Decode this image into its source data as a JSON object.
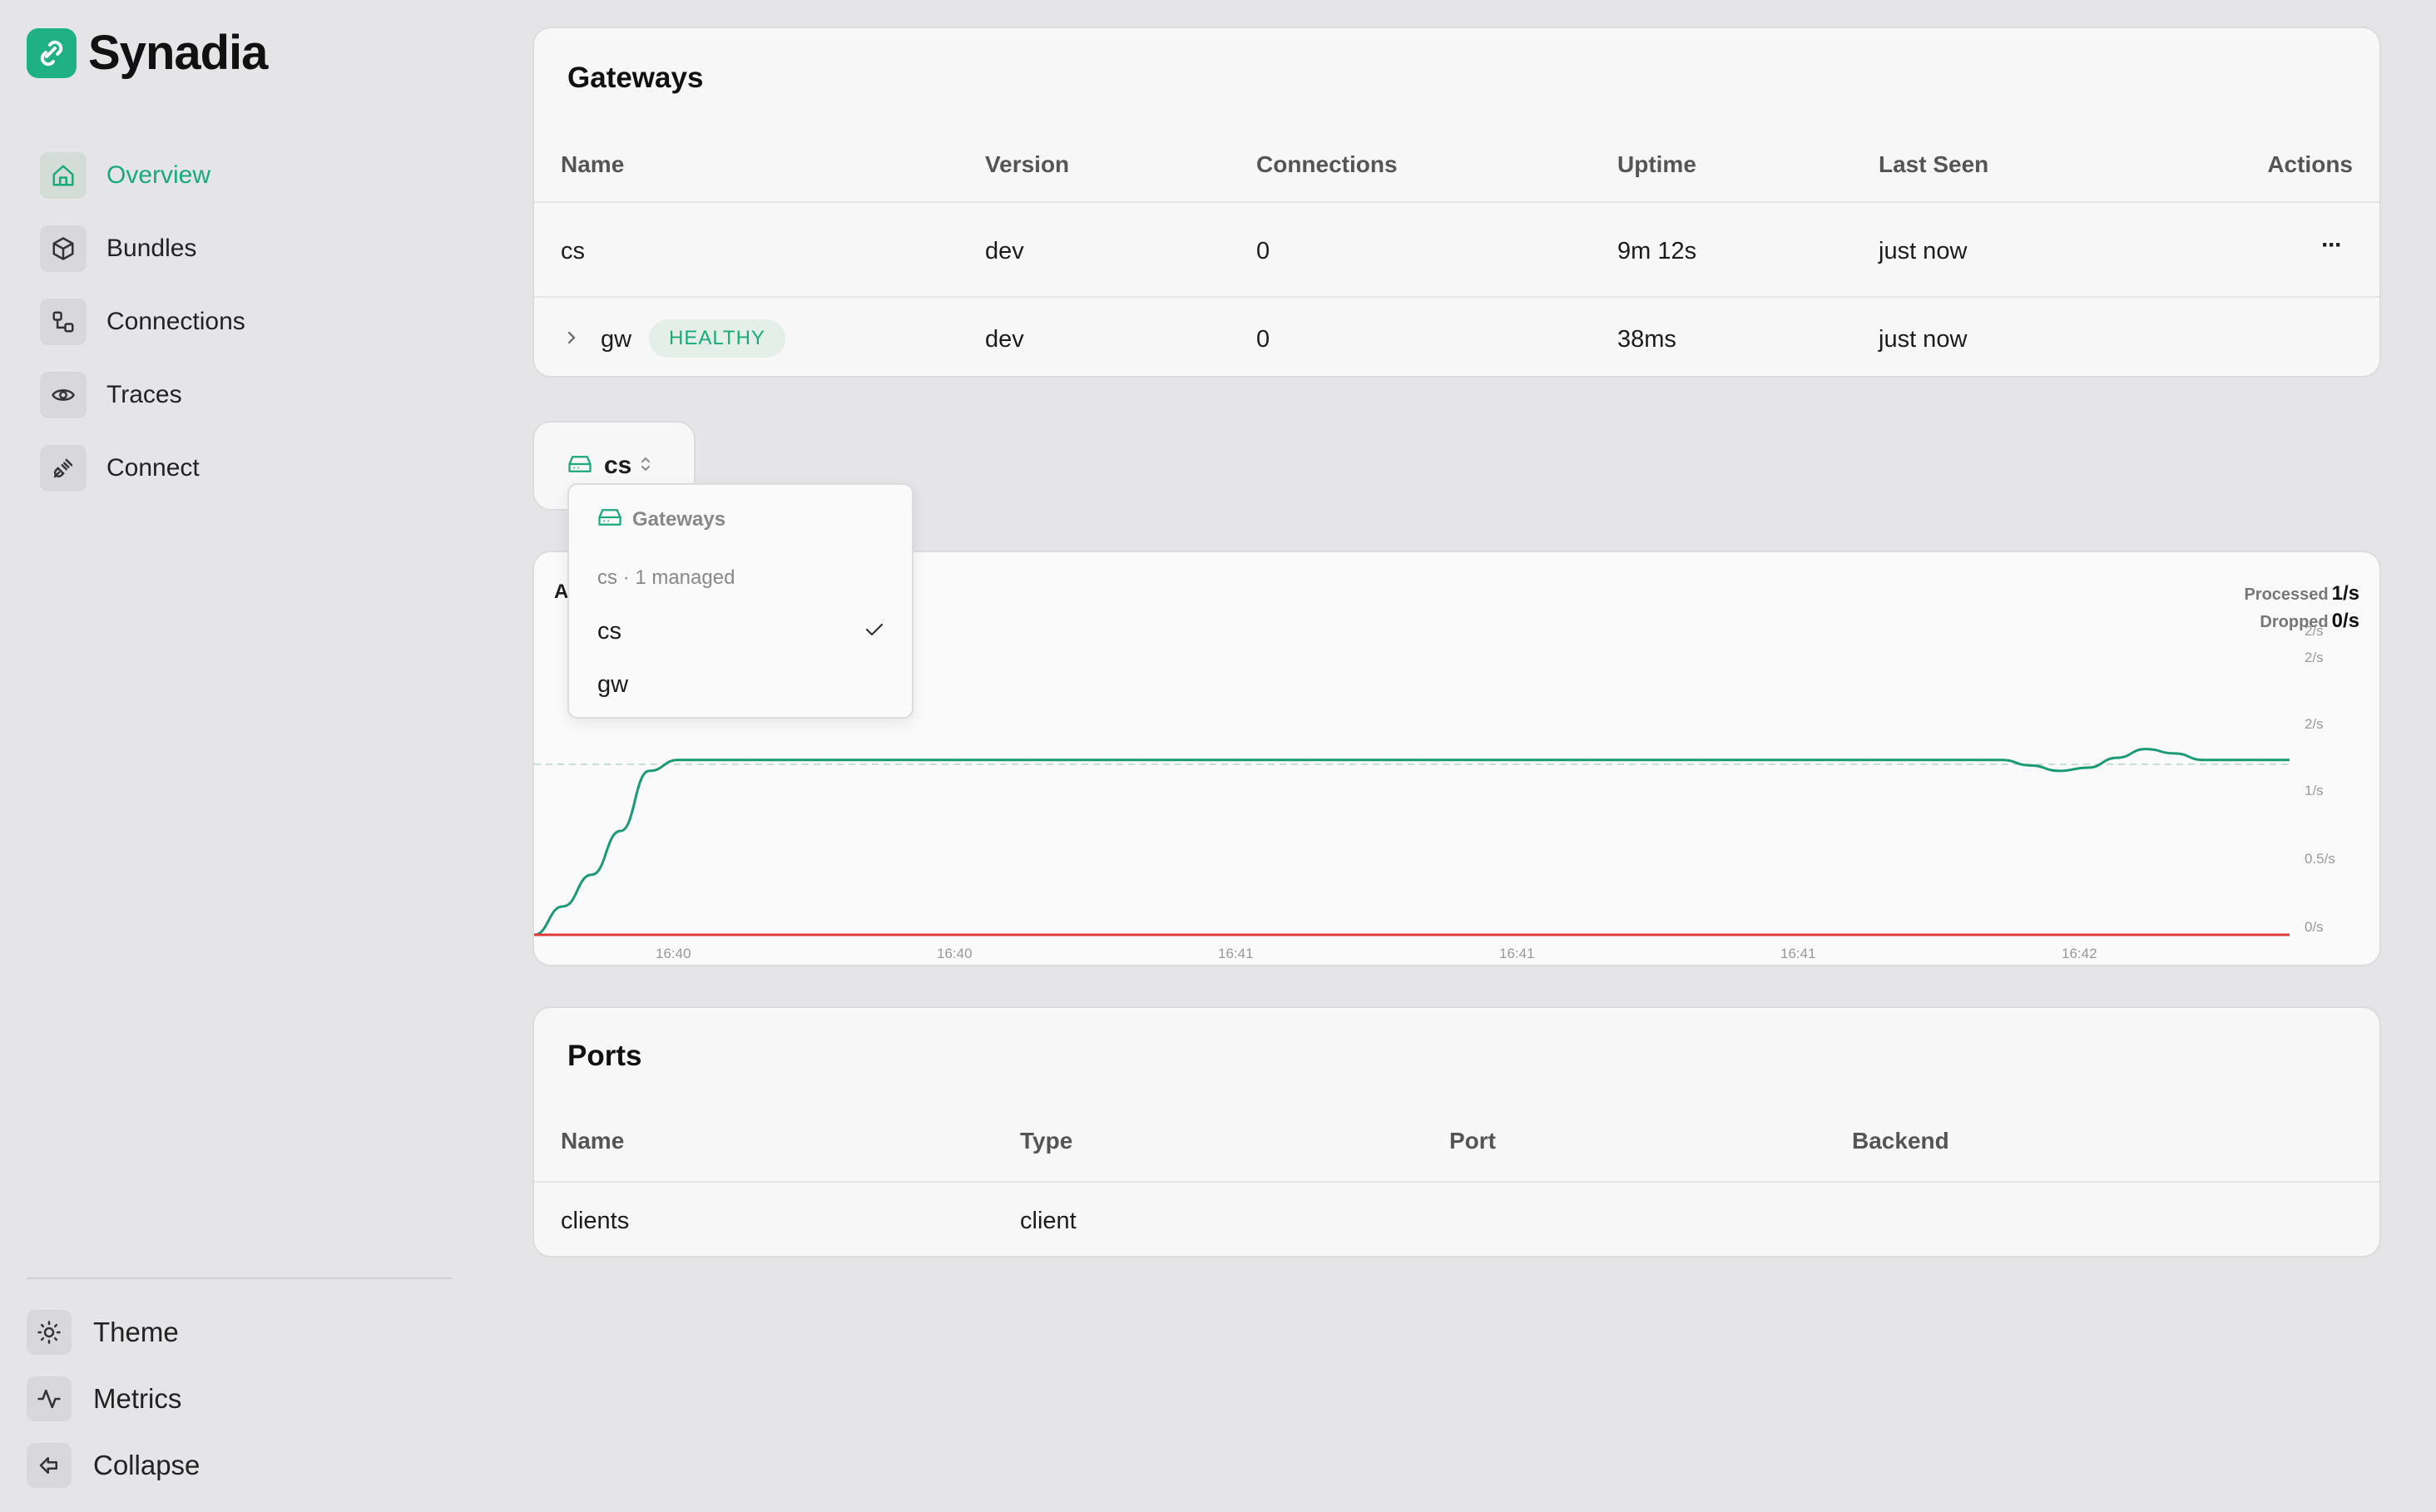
{
  "brand": {
    "name": "Synadia"
  },
  "nav": {
    "items": [
      {
        "label": "Overview",
        "icon": "home-icon",
        "active": true
      },
      {
        "label": "Bundles",
        "icon": "package-icon",
        "active": false
      },
      {
        "label": "Connections",
        "icon": "connections-icon",
        "active": false
      },
      {
        "label": "Traces",
        "icon": "eye-icon",
        "active": false
      },
      {
        "label": "Connect",
        "icon": "plug-icon",
        "active": false
      }
    ],
    "bottom": [
      {
        "label": "Theme",
        "icon": "sun-icon"
      },
      {
        "label": "Metrics",
        "icon": "activity-icon"
      },
      {
        "label": "Collapse",
        "icon": "collapse-arrow-icon"
      }
    ]
  },
  "gateways": {
    "title": "Gateways",
    "columns": [
      "Name",
      "Version",
      "Connections",
      "Uptime",
      "Last Seen",
      "Actions"
    ],
    "rows": [
      {
        "name": "cs",
        "badge": "",
        "version": "dev",
        "connections": "0",
        "uptime": "9m 12s",
        "last_seen": "just now",
        "actions": "···"
      },
      {
        "name": "gw",
        "badge": "HEALTHY",
        "version": "dev",
        "connections": "0",
        "uptime": "38ms",
        "last_seen": "just now",
        "actions": ""
      }
    ]
  },
  "selector": {
    "value": "cs"
  },
  "dropdown": {
    "header": "Gateways",
    "subheader": "cs  · 1 managed",
    "options": [
      {
        "label": "cs",
        "selected": true
      },
      {
        "label": "gw",
        "selected": false
      }
    ]
  },
  "chart": {
    "partial_title": "A",
    "legend": [
      {
        "label": "Processed",
        "value": "1/s"
      },
      {
        "label": "Dropped",
        "value": "0/s"
      }
    ]
  },
  "chart_data": {
    "type": "line",
    "x": [
      "16:40",
      "16:40",
      "16:41",
      "16:41",
      "16:41",
      "16:42"
    ],
    "y_ticks": [
      "2/s",
      "2/s",
      "2/s",
      "1/s",
      "0.5/s",
      "0/s"
    ],
    "series": [
      {
        "name": "Processed",
        "color": "#1a9a74"
      },
      {
        "name": "Dropped",
        "color": "#e03b3b"
      }
    ],
    "processed_profile": [
      0,
      0.26,
      0.55,
      0.95,
      1.5,
      1.6,
      1.6,
      1.6,
      1.6,
      1.6,
      1.6,
      1.6,
      1.6,
      1.6,
      1.6,
      1.6,
      1.6,
      1.6,
      1.6,
      1.6,
      1.6,
      1.6,
      1.6,
      1.6,
      1.6,
      1.6,
      1.6,
      1.6,
      1.6,
      1.6,
      1.6,
      1.6,
      1.6,
      1.6,
      1.6,
      1.6,
      1.6,
      1.6,
      1.6,
      1.6,
      1.6,
      1.6,
      1.6,
      1.6,
      1.6,
      1.6,
      1.6,
      1.6,
      1.6,
      1.6,
      1.6,
      1.6,
      1.55,
      1.5,
      1.53,
      1.62,
      1.7,
      1.66,
      1.6,
      1.6,
      1.6,
      1.6
    ],
    "dropped_value": 0,
    "ylim": [
      0,
      2
    ],
    "reference_line": 1.56
  },
  "ports": {
    "title": "Ports",
    "columns": [
      "Name",
      "Type",
      "Port",
      "Backend"
    ],
    "rows": [
      {
        "name": "clients",
        "type": "client",
        "port": "",
        "backend": ""
      }
    ]
  },
  "colors": {
    "accent": "#19a97b",
    "processed": "#1a9a74",
    "dropped": "#e03b3b",
    "background": "#e5e5e7",
    "card": "#f7f7f7"
  }
}
